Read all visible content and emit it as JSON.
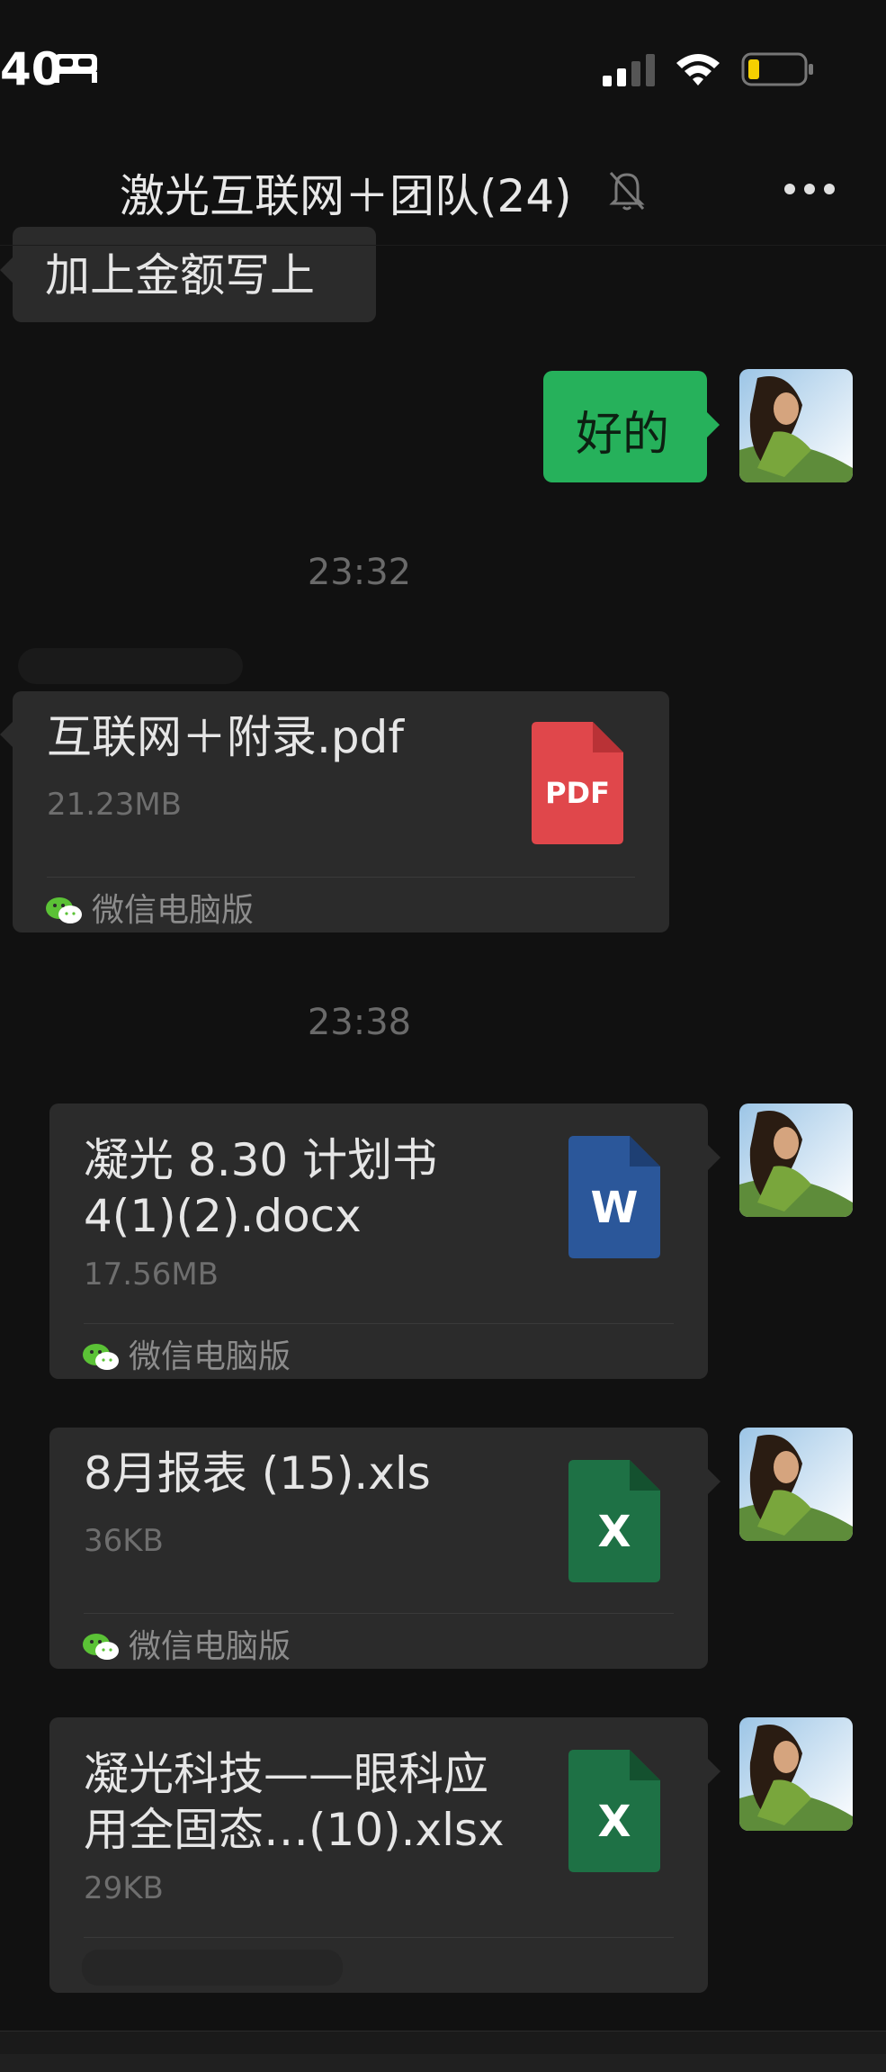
{
  "status_bar": {
    "time": "40",
    "icons": [
      "bed-icon",
      "signal-icon",
      "wifi-icon",
      "battery-icon"
    ],
    "battery_color": "#f5d000"
  },
  "nav": {
    "title": "激光互联网＋团队(24)",
    "icons": [
      "mute-icon",
      "more-icon"
    ]
  },
  "messages": [
    {
      "type": "text",
      "direction": "in",
      "text": "加上金额写上"
    },
    {
      "type": "text",
      "direction": "out",
      "text": "好的"
    },
    {
      "type": "timestamp",
      "text": "23:32"
    },
    {
      "type": "file",
      "direction": "in",
      "name": "互联网＋附录.pdf",
      "size": "21.23MB",
      "source": "微信电脑版",
      "icon": "pdf-icon",
      "icon_label": "PDF",
      "icon_color": "#e0474b"
    },
    {
      "type": "timestamp",
      "text": "23:38"
    },
    {
      "type": "file",
      "direction": "out",
      "name": "凝光 8.30 计划书 4(1)(2).docx",
      "name_lines": [
        "凝光 8.30 计划书",
        "4(1)(2).docx"
      ],
      "size": "17.56MB",
      "source": "微信电脑版",
      "icon": "word-icon",
      "icon_label": "W",
      "icon_color": "#2b579a"
    },
    {
      "type": "file",
      "direction": "out",
      "name": "8月报表 (15).xls",
      "size": "36KB",
      "source": "微信电脑版",
      "icon": "excel-icon",
      "icon_label": "X",
      "icon_color": "#1e7145"
    },
    {
      "type": "file",
      "direction": "out",
      "name": "凝光科技——眼科应用全固态…(10).xlsx",
      "name_lines": [
        "凝光科技——眼科应",
        "用全固态…(10).xlsx"
      ],
      "size": "29KB",
      "icon": "excel-icon",
      "icon_label": "X",
      "icon_color": "#1e7145"
    }
  ],
  "colors": {
    "background": "#111111",
    "bubble_in": "#2b2b2b",
    "bubble_out": "#26b15b",
    "timestamp": "#6a6a6a"
  }
}
